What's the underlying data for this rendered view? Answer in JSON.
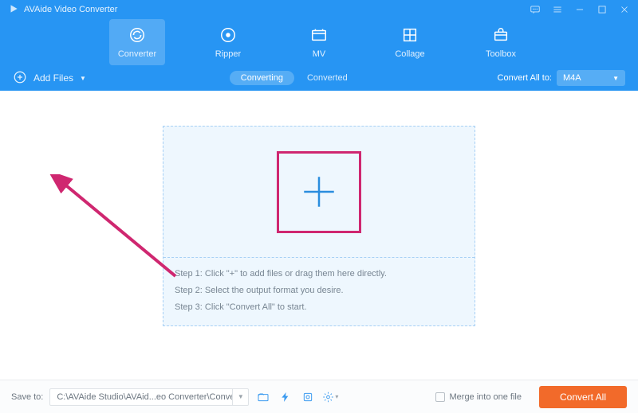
{
  "title": "AVAide Video Converter",
  "nav": {
    "items": [
      {
        "label": "Converter"
      },
      {
        "label": "Ripper"
      },
      {
        "label": "MV"
      },
      {
        "label": "Collage"
      },
      {
        "label": "Toolbox"
      }
    ]
  },
  "subbar": {
    "add_files": "Add Files",
    "tabs": {
      "converting": "Converting",
      "converted": "Converted"
    },
    "convert_all_label": "Convert All to:",
    "convert_all_format": "M4A"
  },
  "dropzone": {
    "step1": "Step 1: Click \"+\" to add files or drag them here directly.",
    "step2": "Step 2: Select the output format you desire.",
    "step3": "Step 3: Click \"Convert All\" to start."
  },
  "footer": {
    "save_to_label": "Save to:",
    "save_path": "C:\\AVAide Studio\\AVAid...eo Converter\\Converted",
    "merge_label": "Merge into one file",
    "convert_button": "Convert All"
  }
}
